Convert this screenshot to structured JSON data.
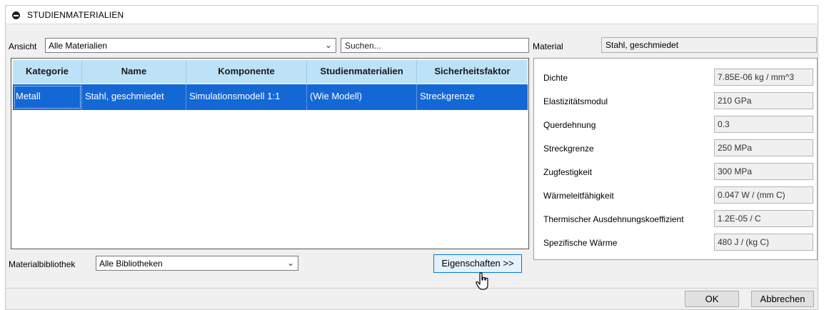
{
  "title": {
    "text": "STUDIENMATERIALIEN",
    "icon": "collapse-icon"
  },
  "view": {
    "label": "Ansicht",
    "selected": "Alle Materialien"
  },
  "search": {
    "placeholder": "Suchen..."
  },
  "material": {
    "label": "Material",
    "value": "Stahl, geschmiedet"
  },
  "table": {
    "headers": [
      "Kategorie",
      "Name",
      "Komponente",
      "Studienmaterialien",
      "Sicherheitsfaktor"
    ],
    "rows": [
      [
        "Metall",
        "Stahl, geschmiedet",
        "Simulationsmodell 1:1",
        "(Wie Modell)",
        "Streckgrenze"
      ]
    ]
  },
  "library": {
    "label": "Materialbibliothek",
    "selected": "Alle Bibliotheken"
  },
  "properties_button": "Eigenschaften >>",
  "properties": [
    {
      "label": "Dichte",
      "value": "7.85E-06 kg / mm^3"
    },
    {
      "label": "Elastizitätsmodul",
      "value": "210 GPa"
    },
    {
      "label": "Querdehnung",
      "value": "0.3"
    },
    {
      "label": "Streckgrenze",
      "value": "250 MPa"
    },
    {
      "label": "Zugfestigkeit",
      "value": "300 MPa"
    },
    {
      "label": "Wärmeleitfähigkeit",
      "value": "0.047 W / (mm C)"
    },
    {
      "label": "Thermischer Ausdehnungskoeffizient",
      "value": "1.2E-05 / C"
    },
    {
      "label": "Spezifische Wärme",
      "value": "480 J / (kg C)"
    }
  ],
  "footer": {
    "ok_label": "OK",
    "cancel_label": "Abbrechen"
  },
  "colors": {
    "selection": "#1468d6",
    "header": "#bde2f7",
    "dialog_bg": "#f0f0f0"
  }
}
